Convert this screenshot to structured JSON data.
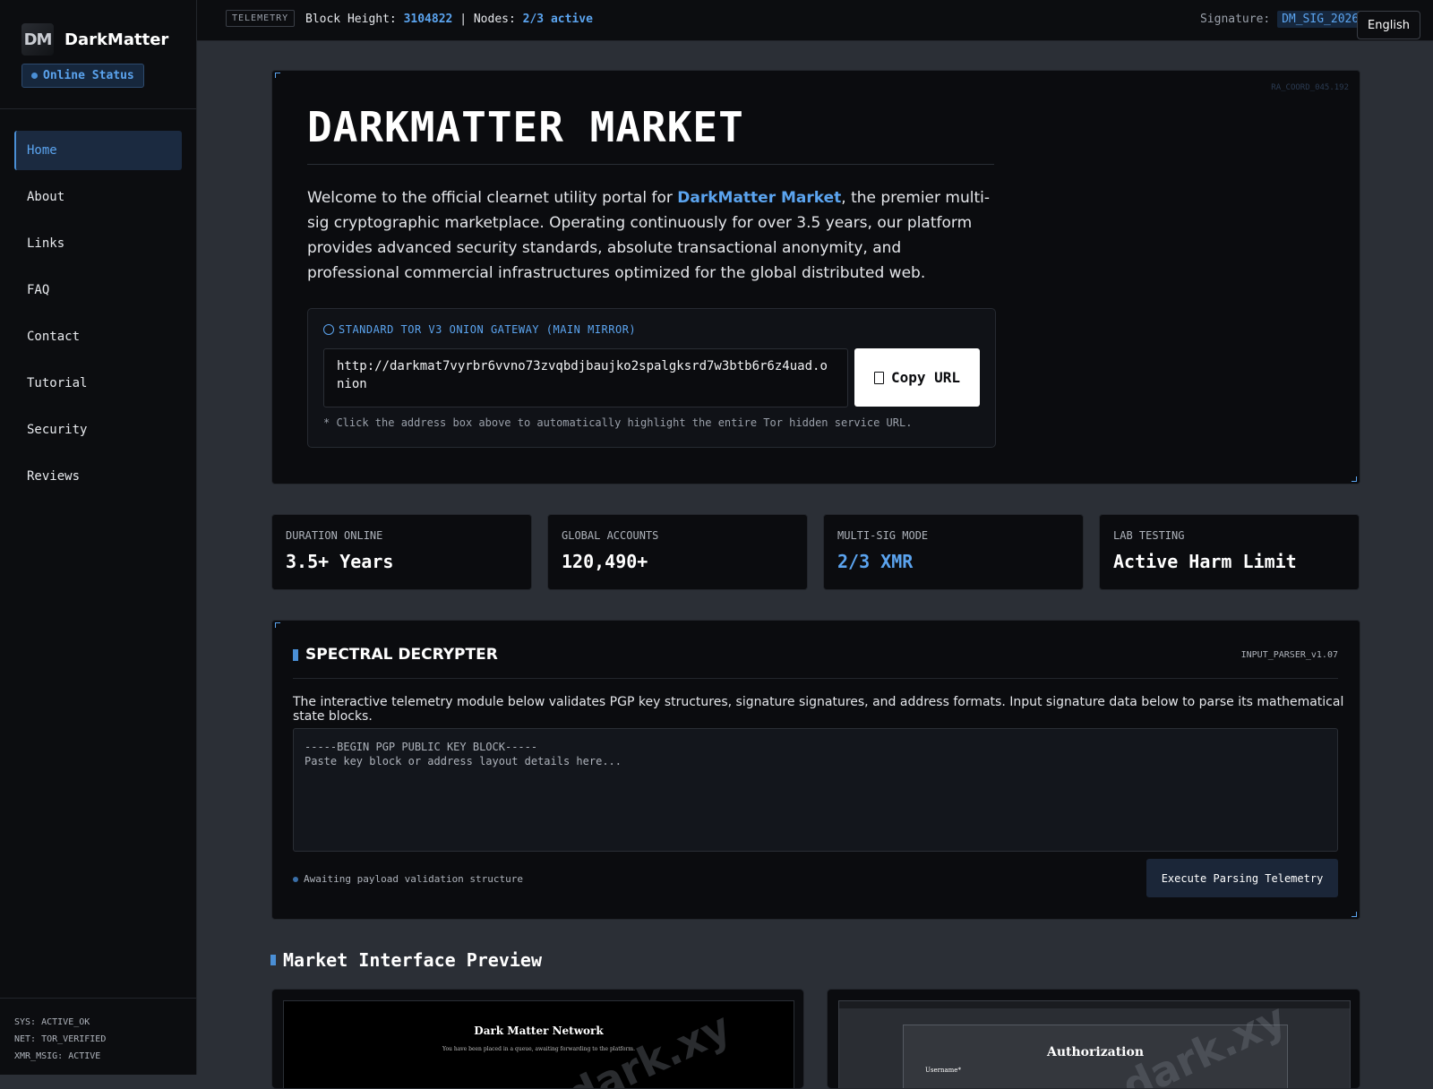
{
  "sidebar": {
    "logo_text": "DM",
    "brand": "DarkMatter",
    "status": "Online Status",
    "items": [
      {
        "label": "Home",
        "active": true
      },
      {
        "label": "About"
      },
      {
        "label": "Links"
      },
      {
        "label": "FAQ"
      },
      {
        "label": "Contact"
      },
      {
        "label": "Tutorial"
      },
      {
        "label": "Security"
      },
      {
        "label": "Reviews"
      }
    ],
    "footer": [
      "SYS: ACTIVE_OK",
      "NET: TOR_VERIFIED",
      "XMR_MSIG: ACTIVE"
    ]
  },
  "topbar": {
    "tag": "TELEMETRY",
    "block_label": "Block Height:",
    "block_value": "3104822",
    "separator": "|",
    "nodes_label": "Nodes:",
    "nodes_value": "2/3 active",
    "signature_label": "Signature:",
    "signature_value": "DM_SIG_2026_",
    "language": "English"
  },
  "hero": {
    "coord": "RA_COORD_045.192",
    "title": "DARKMATTER MARKET",
    "para_before": "Welcome to the official clearnet utility portal for ",
    "para_highlight": "DarkMatter Market",
    "para_after": ", the premier multi-sig cryptographic marketplace. Operating continuously for over 3.5 years, our platform provides advanced security standards, absolute transactional anonymity, and professional commercial infrastructures optimized for the global distributed web.",
    "gateway_label": "STANDARD TOR V3 ONION GATEWAY (MAIN MIRROR)",
    "url": "http://darkmat7vyrbr6vvno73zvqbdjbaujko2spalgksrd7w3btb6r6z4uad.onion",
    "copy_label": "Copy URL",
    "note": "* Click the address box above to automatically highlight the entire Tor hidden service URL."
  },
  "stats": [
    {
      "label": "DURATION ONLINE",
      "value": "3.5+ Years"
    },
    {
      "label": "GLOBAL ACCOUNTS",
      "value": "120,490+"
    },
    {
      "label": "MULTI-SIG MODE",
      "value": "2/3 XMR"
    },
    {
      "label": "LAB TESTING",
      "value": "Active Harm Limit"
    }
  ],
  "decrypter": {
    "title": "SPECTRAL DECRYPTER",
    "version": "INPUT_PARSER_v1.07",
    "description": "The interactive telemetry module below validates PGP key structures, signature signatures, and address formats. Input signature data below to parse its mathematical state blocks.",
    "placeholder": "-----BEGIN PGP PUBLIC KEY BLOCK-----\nPaste key block or address layout details here...",
    "status": "Awaiting payload validation structure",
    "button": "Execute Parsing Telemetry"
  },
  "preview": {
    "heading": "Market Interface Preview",
    "shot1_title": "Dark Matter Network",
    "shot1_sub": "You have been placed in a queue, awaiting forwarding to the platform.",
    "shot2_title": "Authorization",
    "shot2_user": "Username*",
    "watermark": "dark.xy"
  },
  "colors": {
    "accent": "#5ba4ef",
    "panel": "#0b0c0f",
    "background": "#2b2f36"
  }
}
